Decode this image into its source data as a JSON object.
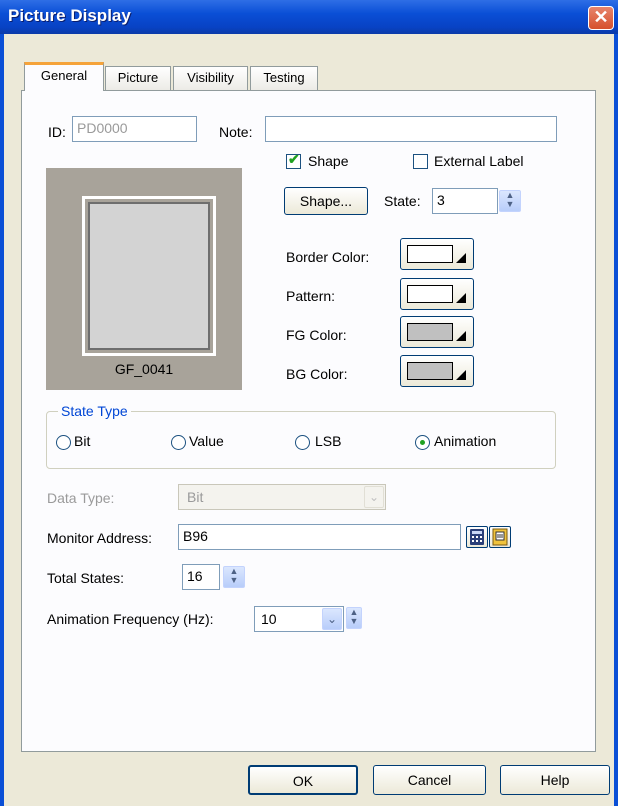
{
  "window": {
    "title": "Picture Display",
    "close_glyph": "✕"
  },
  "tabs": [
    {
      "label": "General",
      "active": true
    },
    {
      "label": "Picture",
      "active": false
    },
    {
      "label": "Visibility",
      "active": false
    },
    {
      "label": "Testing",
      "active": false
    }
  ],
  "general": {
    "id_label": "ID:",
    "id_value": "PD0000",
    "note_label": "Note:",
    "note_value": "",
    "preview_name": "GF_0041",
    "shape_checkbox": {
      "label": "Shape",
      "checked": true
    },
    "external_label_checkbox": {
      "label": "External Label",
      "checked": false
    },
    "shape_button": "Shape...",
    "state_label": "State:",
    "state_value": "3",
    "colors": [
      {
        "label": "Border Color:",
        "swatch": "#ffffff"
      },
      {
        "label": "Pattern:",
        "swatch": "#ffffff"
      },
      {
        "label": "FG Color:",
        "swatch": "#c0c0c0"
      },
      {
        "label": "BG Color:",
        "swatch": "#c0c0c0"
      }
    ],
    "state_type": {
      "title": "State Type",
      "options": [
        {
          "label": "Bit",
          "selected": false
        },
        {
          "label": "Value",
          "selected": false
        },
        {
          "label": "LSB",
          "selected": false
        },
        {
          "label": "Animation",
          "selected": true
        }
      ]
    },
    "data_type_label": "Data Type:",
    "data_type_value": "Bit",
    "monitor_address_label": "Monitor Address:",
    "monitor_address_value": "B96",
    "total_states_label": "Total States:",
    "total_states_value": "16",
    "animation_frequency_label": "Animation Frequency (Hz):",
    "animation_frequency_value": "10"
  },
  "buttons": {
    "ok": "OK",
    "cancel": "Cancel",
    "help": "Help"
  },
  "accent_colors": {
    "titlebar": "#0a4fd6",
    "active_tab_top": "#f5a33a",
    "check": "#21a121"
  }
}
